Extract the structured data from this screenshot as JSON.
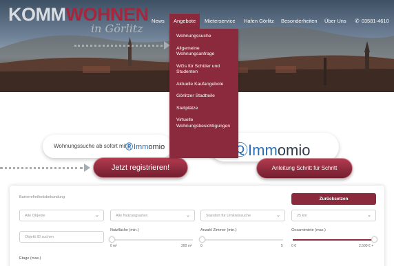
{
  "header": {
    "logo_part1": "KOMM",
    "logo_part2": "WOHNEN",
    "logo_script": "in Görlitz"
  },
  "nav": {
    "items": [
      "News",
      "Angebote",
      "Mieterservice",
      "Hafen Görlitz",
      "Besonderheiten",
      "Über Uns"
    ],
    "active": "Angebote",
    "phone": "03581-4610"
  },
  "dropdown": {
    "items": [
      "Wohnungssuche",
      "Allgemeine Wohnungsanfrage",
      "WGs für Schüler und Studenten",
      "Aktuelle Kaufangebote",
      "Görlitzer Stadtteile",
      "Stellplätze",
      "Virtuelle Wohnungsbesichtigungen"
    ]
  },
  "banner": {
    "pill_text": "Wohnungssuche ab sofort mit",
    "brand_im": "Imm",
    "brand_io": "omio",
    "brand_full_im": "Imm",
    "brand_full_io": "omio",
    "register_button": "Jetzt registrieren!",
    "guide_button": "Anleitung Schritt für Schritt"
  },
  "filters": {
    "title": "Barrierefreiheitsbekundung",
    "reset_button": "Zurücksetzen",
    "objects_placeholder": "Alle Objekte",
    "usage_placeholder": "Alle Nutzungsarten",
    "location_placeholder": "Standort für Umkreissuche",
    "radius_value": "25 km",
    "object_id_placeholder": "Objekt ID suchen",
    "area_label": "Nutzfläche (min.)",
    "area_min": "0 m²",
    "area_max": "200 m²",
    "area_fraction": 0,
    "rooms_label": "Anzahl Zimmer (min.)",
    "rooms_min": "0",
    "rooms_max": "5",
    "rooms_fraction": 0,
    "rent_label": "Gesamtmiete (max.)",
    "rent_min": "0 €",
    "rent_max": "2.500 € +",
    "rent_fraction": 1,
    "floor_label": "Etage (max.)"
  },
  "colors": {
    "brand": "#8a2a3c",
    "immomio_blue": "#2b6fb6"
  }
}
